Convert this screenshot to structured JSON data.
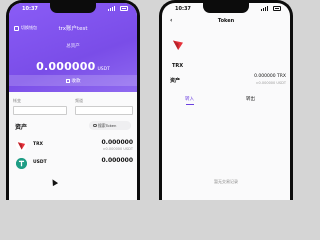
{
  "colors": {
    "accent": "#8a5cf6",
    "tron_red": "#e5313a",
    "usdt_green": "#1f9d85"
  },
  "left": {
    "status_time": "10:37",
    "switch_label": "切换钱包",
    "account_title": "trx账户test",
    "total_label": "总资产",
    "total_value": "0.000000",
    "total_unit": "USDT",
    "receive_label": "收款",
    "field1_label": "帐变",
    "field2_label": "频道",
    "assets_title": "资产",
    "search_label": "搜索Token",
    "assets": [
      {
        "symbol": "TRX",
        "amount": "0.000000",
        "usd": "≈0.000000 USDT",
        "icon": "tron-icon"
      },
      {
        "symbol": "USDT",
        "amount": "0.000000",
        "usd": "≈0.000000 USDT",
        "icon": "tether-icon"
      }
    ]
  },
  "right": {
    "status_time": "10:37",
    "back_symbol": "‹",
    "title": "Token",
    "token_name": "TRX",
    "assets_label": "资产",
    "amount": "0.000000 TRX",
    "usd": "≈0.000000 USDT",
    "tabs": [
      "转入",
      "转出"
    ],
    "empty_text": "暂无交易记录"
  }
}
